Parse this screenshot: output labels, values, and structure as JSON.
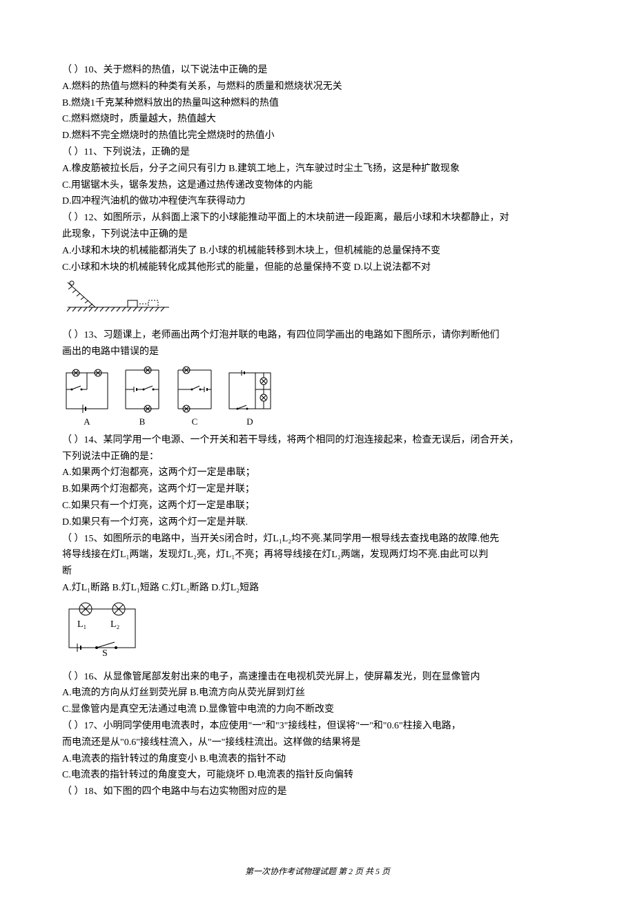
{
  "q10": {
    "stem": "（  ）10、关于燃料的热值，以下说法中正确的是",
    "A": "A.燃料的热值与燃料的种类有关系，与燃料的质量和燃烧状况无关",
    "B": "B.燃烧1千克某种燃料放出的热量叫这种燃料的热值",
    "C": "C.燃料燃烧时，质量越大，热值越大",
    "D": "D.燃料不完全燃烧时的热值比完全燃烧时的热值小"
  },
  "q11": {
    "stem": "（  ）11、下列说法，正确的是",
    "A": "A.橡皮筋被拉长后，分子之间只有引力 B.建筑工地上，汽车驶过时尘土飞扬，这是种扩散现象",
    "C": "C.用锯锯木头，锯条发热，这是通过热传递改变物体的内能",
    "D": "D.四冲程汽油机的做功冲程使汽车获得动力"
  },
  "q12": {
    "stem1": "（  ）12、如图所示，从斜面上滚下的小球能推动平面上的木块前进一段距离，最后小球和木块都静止，对",
    "stem2": "此现象，下列说法中正确的是",
    "A": "A.小球和木块的机械能都消失了 B.小球的机械能转移到木块上，但机械能的总量保持不变",
    "C": "C.小球和木块的机械能转化成其他形式的能量，但能的总量保持不变 D.以上说法都不对"
  },
  "q13": {
    "stem1": "（  ）13、习题课上，老师画出两个灯泡并联的电路，有四位同学画出的电路如下图所示，请你判断他们",
    "stem2": "画出的电路中错误的是",
    "labels": {
      "a": "A",
      "b": "B",
      "c": "C",
      "d": "D"
    }
  },
  "q14": {
    "stem1": "（  ）14、某同学用一个电源、一个开关和若干导线，将两个相同的灯泡连接起来，检查无误后，闭合开关，",
    "stem2": "下列说法中正确的是：",
    "A": "A.如果两个灯泡都亮，这两个灯一定是串联；",
    "B": "B.如果两个灯泡都亮，这两个灯一定是并联；",
    "C": "C.如果只有一个灯亮，这两个灯一定是串联；",
    "D": "D.如果只有一个灯亮，这两个灯一定是并联."
  },
  "q15": {
    "stem1": "（  ）15、如图所示的电路中，当开关S闭合时，灯L₁L₂均不亮.某同学用一根导线去查找电路的故障.他先",
    "stem2": "将导线接在灯L₁两端，发现灯L₂亮，灯L₁不亮；再将导线接在灯L₂两端，发现两灯均不亮.由此可以判",
    "stem3": "断",
    "A": "A.灯L₁断路    B.灯L₁短路    C.灯L₂断路    D.灯L₂短路",
    "L1": "L₁",
    "L2": "L₂",
    "S": "S"
  },
  "q16": {
    "stem": "（  ）16、从显像管尾部发射出来的电子，高速撞击在电视机荧光屏上，使屏幕发光，则在显像管内",
    "row1": "A.电流的方向从灯丝到荧光屏      B.电流方向从荧光屏到灯丝",
    "row2": "C.显像管内是真空无法通过电流    D.显像管中电流的力向不断改变"
  },
  "q17": {
    "stem1": "（  ）17、小明同学使用电流表时，本应使用\"一\"和\"3\"接线柱，但误将\"一\"和\"0.6\"柱接入电路，",
    "stem2": "而电流还是从\"0.6\"接线柱流入，从\"一\"接线柱流出。这样做的结果将是",
    "row1": "A.电流表的指针转过的角度变小          B.电流表的指针不动",
    "row2": "C.电流表的指针转过的角度变大，可能烧坏  D.电流表的指针反向偏转"
  },
  "q18": {
    "stem": "（  ）18、如下图的四个电路中与右边实物图对应的是"
  },
  "footer": "第一次协作考试物理试题  第 2 页 共 5 页"
}
